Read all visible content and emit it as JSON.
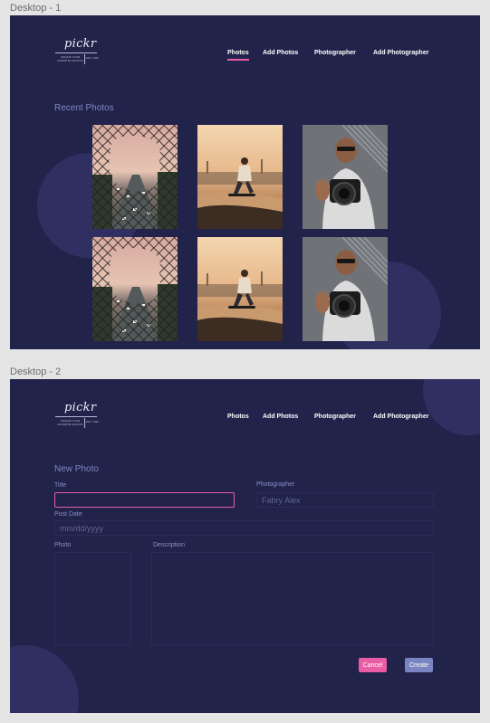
{
  "frames": [
    {
      "label": "Desktop - 1",
      "logo": {
        "wordmark": "pickr",
        "tagline": "UNIQUE YOUR FAVORITE PHOTOS",
        "est": "EST. 2020"
      },
      "nav": {
        "items": [
          {
            "label": "Photos",
            "active": true
          },
          {
            "label": "Add Photos",
            "active": false
          },
          {
            "label": "Photographer",
            "active": false
          },
          {
            "label": "Add Photographer",
            "active": false
          }
        ]
      },
      "section_title": "Recent Photos",
      "photos": [
        {
          "subject": "highway-through-broken-fence"
        },
        {
          "subject": "skateboarder-at-sunset"
        },
        {
          "subject": "man-holding-camera"
        },
        {
          "subject": "highway-through-broken-fence"
        },
        {
          "subject": "skateboarder-at-sunset"
        },
        {
          "subject": "man-holding-camera"
        }
      ]
    },
    {
      "label": "Desktop - 2",
      "logo": {
        "wordmark": "pickr",
        "tagline": "UNIQUE YOUR FAVORITE PHOTOS",
        "est": "EST. 2020"
      },
      "nav": {
        "items": [
          {
            "label": "Photos",
            "active": false
          },
          {
            "label": "Add Photos",
            "active": false
          },
          {
            "label": "Photographer",
            "active": false
          },
          {
            "label": "Add Photographer",
            "active": false
          }
        ]
      },
      "form": {
        "title": "New Photo",
        "title_label": "Title",
        "title_value": "",
        "photographer_label": "Photographer",
        "photographer_value": "Fabry Alex",
        "post_date_label": "Post Date",
        "post_date_placeholder": "mm/dd/yyyy",
        "photo_label": "Photo",
        "description_label": "Description",
        "cancel_label": "Cancel",
        "create_label": "Create"
      }
    }
  ],
  "colors": {
    "page_background": "#e4e4e4",
    "frame_background": "#22234a",
    "decor_circle": "#2f3061",
    "accent_pink": "#e85da3",
    "accent_blue": "#7985c2",
    "muted_text": "#7f86c6"
  }
}
